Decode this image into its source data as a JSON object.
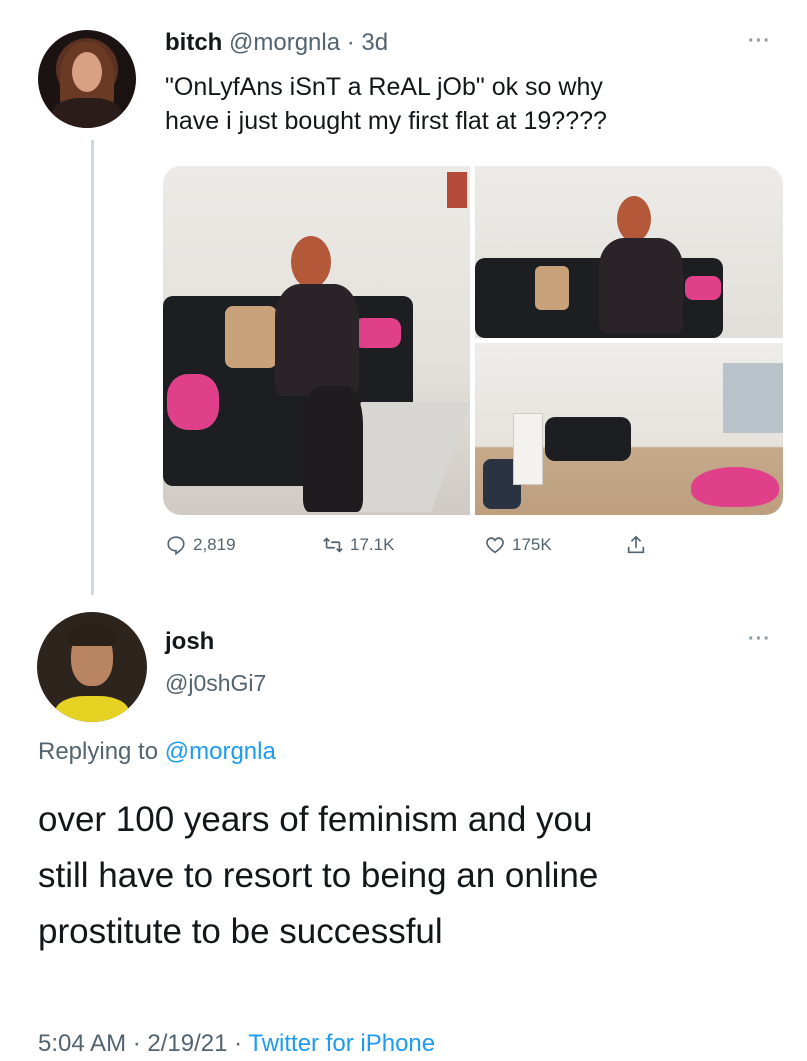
{
  "tweet1": {
    "display_name": "bitch",
    "handle_time": "@morgnla · 3d",
    "text_line1": "\"OnLyfAns iSnT a ReAL jOb\" ok so why",
    "text_line2": "have i just bought my first flat at 19????",
    "counts": {
      "replies": "2,819",
      "retweets": "17.1K",
      "likes": "175K"
    },
    "more_label": "···"
  },
  "tweet2": {
    "display_name": "josh",
    "handle": "@j0shGi7",
    "replying_prefix": "Replying to",
    "replying_handle": "@morgnla",
    "text_line1": "over 100 years of feminism and you",
    "text_line2": "still have to resort to being an online",
    "text_line3": "prostitute to be successful",
    "timestamp": "5:04 AM · 2/19/21 · ",
    "source": "Twitter for iPhone",
    "more_label": "···"
  },
  "colors": {
    "text": "#14171a",
    "secondary": "#536471",
    "link": "#1d9bf0",
    "accent_pink": "#e0408a"
  },
  "icons": [
    "reply-icon",
    "retweet-icon",
    "like-icon",
    "share-icon",
    "more-icon"
  ]
}
